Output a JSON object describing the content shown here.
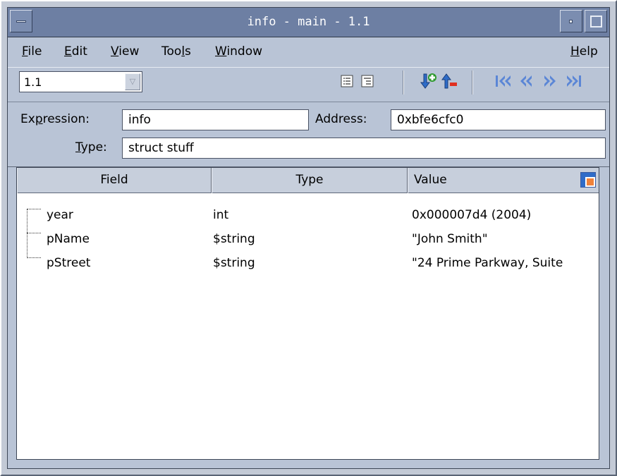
{
  "window": {
    "title": "info - main - 1.1"
  },
  "menu": {
    "items": [
      {
        "label": "File",
        "mnemonic": "F",
        "rest": "ile"
      },
      {
        "label": "Edit",
        "mnemonic": "E",
        "rest": "dit"
      },
      {
        "label": "View",
        "mnemonic": "V",
        "rest": "iew"
      },
      {
        "label": "Tools",
        "pre": "Too",
        "mnemonic": "l",
        "rest": "s"
      },
      {
        "label": "Window",
        "mnemonic": "W",
        "rest": "indow"
      },
      {
        "label": "Help",
        "mnemonic": "H",
        "rest": "elp"
      }
    ]
  },
  "toolbar": {
    "thread_value": "1.1"
  },
  "expression": {
    "expression_label_pre": "Ex",
    "expression_label_mn": "p",
    "expression_label_rest": "ression:",
    "expression_value": "info",
    "address_label": "Address:",
    "address_value": "0xbfe6cfc0",
    "type_label_mn": "T",
    "type_label_rest": "ype:",
    "type_value": "struct stuff"
  },
  "table": {
    "columns": [
      "Field",
      "Type",
      "Value"
    ],
    "rows": [
      {
        "field": "year",
        "type": "int",
        "value": "0x000007d4 (2004)"
      },
      {
        "field": "pName",
        "type": "$string",
        "value": "\"John Smith\""
      },
      {
        "field": "pStreet",
        "type": "$string",
        "value": "\"24 Prime Parkway, Suite"
      }
    ]
  },
  "colors": {
    "titlebar": "#6d7fa3",
    "chrome": "#b9c4d6",
    "accent_green": "#2f9a2f",
    "accent_blue": "#2f6cc8",
    "accent_orange": "#f0823a"
  },
  "icons": [
    "window-menu-icon",
    "minimize-icon",
    "maximize-icon",
    "dropdown-arrow-icon",
    "expand-list-icon",
    "collapse-list-icon",
    "dive-icon",
    "undive-icon",
    "first-icon",
    "previous-icon",
    "next-icon",
    "last-icon",
    "column-chooser-icon"
  ]
}
